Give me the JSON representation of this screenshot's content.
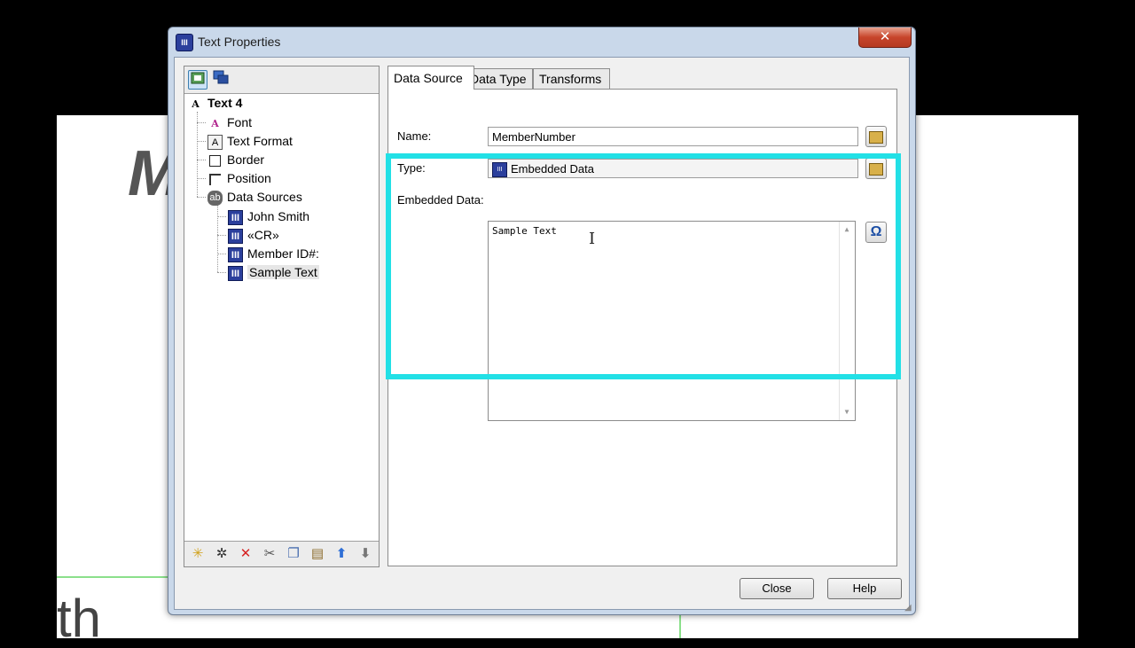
{
  "background": {
    "glyph_top": "M",
    "glyph_bottom": "th"
  },
  "window": {
    "title": "Text Properties",
    "close_glyph": "✕",
    "app_icon_text": "III"
  },
  "tree_toolbar": {
    "btn1_icon": "structure-view-icon",
    "btn2_icon": "layers-icon"
  },
  "tree": {
    "root": "Text 4",
    "items": [
      {
        "label": "Font",
        "icon": "font-icon"
      },
      {
        "label": "Text Format",
        "icon": "text-format-icon"
      },
      {
        "label": "Border",
        "icon": "border-icon"
      },
      {
        "label": "Position",
        "icon": "position-icon"
      },
      {
        "label": "Data Sources",
        "icon": "data-sources-icon"
      }
    ],
    "sources": [
      "John Smith",
      "«CR»",
      "Member ID#:",
      "Sample Text"
    ],
    "selected": "Sample Text"
  },
  "tree_bottom_toolbar": [
    "new-icon",
    "wand-icon",
    "delete-icon",
    "cut-icon",
    "copy-icon",
    "paste-icon",
    "move-up-icon",
    "move-down-icon"
  ],
  "tabs": [
    {
      "label": "Data Source",
      "active": true
    },
    {
      "label": "Data Type",
      "active": false
    },
    {
      "label": "Transforms",
      "active": false
    }
  ],
  "form": {
    "name_label": "Name:",
    "name_value": "MemberNumber",
    "type_label": "Type:",
    "type_value": "Embedded Data",
    "embedded_label": "Embedded Data:",
    "embedded_value": "Sample Text",
    "omega_glyph": "Ω"
  },
  "buttons": {
    "close": "Close",
    "help": "Help"
  },
  "colors": {
    "highlight": "#22e0e6",
    "datasource_icon": "#2b3f9c",
    "close_button": "#c7452b"
  }
}
